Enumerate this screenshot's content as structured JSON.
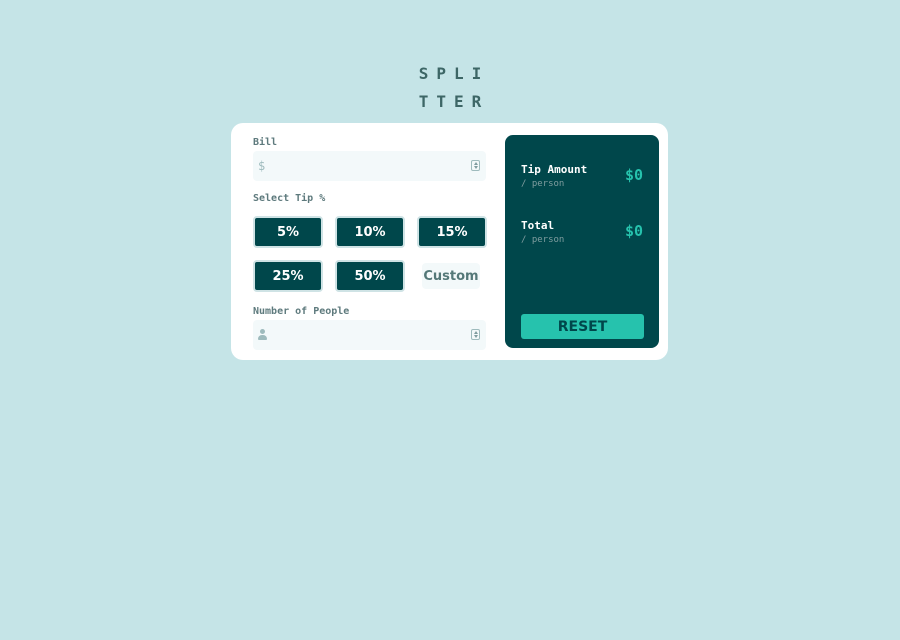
{
  "app": {
    "logo_line1": "SPLI",
    "logo_line2": "TTER"
  },
  "bill": {
    "label": "Bill",
    "prefix_icon": "dollar-icon",
    "value": "",
    "placeholder": ""
  },
  "tip": {
    "label": "Select Tip %",
    "options": [
      "5%",
      "10%",
      "15%",
      "25%",
      "50%"
    ],
    "custom_placeholder": "Custom"
  },
  "people": {
    "label": "Number of People",
    "prefix_icon": "person-icon",
    "value": "",
    "placeholder": ""
  },
  "results": {
    "tip_amount_label": "Tip Amount",
    "tip_amount_sub": "/ person",
    "tip_amount_value": "$0",
    "total_label": "Total",
    "total_sub": "/ person",
    "total_value": "$0",
    "reset_label": "RESET"
  },
  "colors": {
    "background": "#c5e4e7",
    "card": "#ffffff",
    "dark_cyan": "#00474b",
    "accent": "#26c2ad",
    "input_bg": "#f3f9fa",
    "label": "#5e7a7d"
  }
}
